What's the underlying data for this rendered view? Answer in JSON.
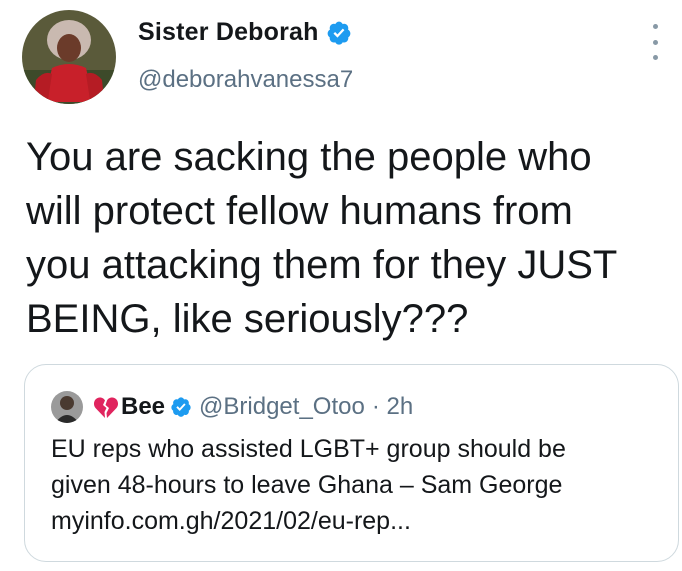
{
  "tweet": {
    "author": {
      "display_name": "Sister Deborah",
      "handle": "@deborahvanessa7",
      "verified": true,
      "avatar_icon": "profile-photo"
    },
    "menu_icon": "more-vertical-icon",
    "text_lines": [
      "You are sacking the people who",
      "will protect fellow humans from",
      "you attacking them for they JUST",
      "BEING, like seriously???"
    ]
  },
  "quote_tweet": {
    "author": {
      "emoji_icon": "broken-heart-icon",
      "display_name": "Bee",
      "verified": true,
      "handle": "@Bridget_Otoo",
      "time": "· 2h"
    },
    "text_lines": [
      "EU reps who assisted LGBT+ group should be",
      "given 48-hours to leave Ghana – Sam George",
      "myinfo.com.gh/2021/02/eu-rep..."
    ]
  },
  "colors": {
    "verified_blue": "#1d9bf0",
    "secondary_text": "#5b7083",
    "border": "#cfd9de",
    "heart_red": "#e0245e"
  }
}
